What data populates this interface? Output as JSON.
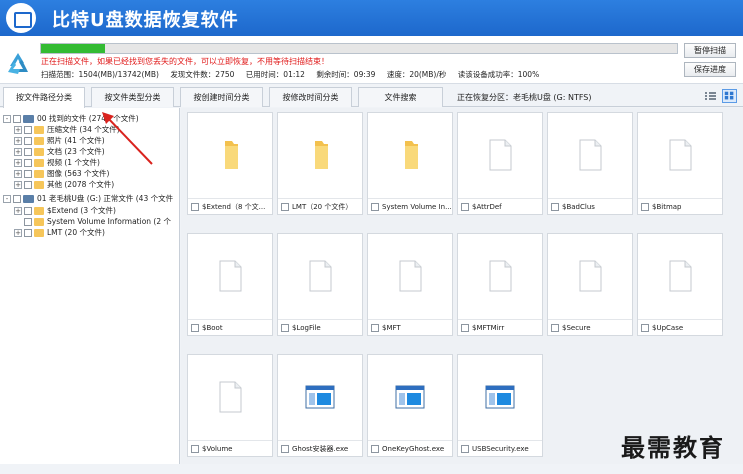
{
  "app": {
    "title": "比特U盘数据恢复软件"
  },
  "scan": {
    "progress": 0.1,
    "warning": "正在扫描文件，如果已经找到您丢失的文件，可以立即恢复，不用等待扫描结束！",
    "range": "扫描范围：1504(MB)/13742(MB)",
    "files_found": "发现文件数：2750",
    "elapsed": "已用时间：01:12",
    "remaining": "剩余时间：09:39",
    "speed": "速度：20(MB)/秒",
    "read_rate": "读该设备成功率：100%",
    "pause_label": "暂停扫描",
    "save_label": "保存进度"
  },
  "tabs": {
    "items": [
      "按文件路径分类",
      "按文件类型分类",
      "按创建时间分类",
      "按修改时间分类",
      "文件搜索"
    ],
    "current_partition": "正在恢复分区：老毛桃U盘 (G: NTFS)"
  },
  "tree": {
    "nodes": [
      {
        "expander": "-",
        "label": "00 找到的文件",
        "count": "(2740 个文件)",
        "kind": "drive"
      },
      {
        "expander": "+",
        "label": "压缩文件",
        "count": "(34 个文件)",
        "kind": "folder"
      },
      {
        "expander": "+",
        "label": "照片",
        "count": "(41 个文件)",
        "kind": "folder"
      },
      {
        "expander": "+",
        "label": "文档",
        "count": "(23 个文件)",
        "kind": "folder"
      },
      {
        "expander": "+",
        "label": "视频",
        "count": "(1 个文件)",
        "kind": "folder"
      },
      {
        "expander": "+",
        "label": "图像",
        "count": "(563 个文件)",
        "kind": "folder"
      },
      {
        "expander": "+",
        "label": "其他",
        "count": "(2078 个文件)",
        "kind": "folder"
      },
      {
        "expander": "-",
        "label": "01 老毛桃U盘",
        "count": "(G:) 正常文件 (43 个文件",
        "kind": "drive"
      },
      {
        "expander": "+",
        "label": "$Extend",
        "count": "(3 个文件)",
        "kind": "folder"
      },
      {
        "expander": "",
        "label": "System Volume Information",
        "count": "(2 个",
        "kind": "folder"
      },
      {
        "expander": "+",
        "label": "LMT",
        "count": "(20 个文件)",
        "kind": "folder"
      }
    ]
  },
  "files": [
    {
      "name": "$Extend（8 个文...",
      "icon": "folder-icon"
    },
    {
      "name": "LMT（20 个文件）",
      "icon": "folder-icon"
    },
    {
      "name": "System Volume In...",
      "icon": "folder-icon"
    },
    {
      "name": "$AttrDef",
      "icon": "file-icon"
    },
    {
      "name": "$BadClus",
      "icon": "file-icon"
    },
    {
      "name": "$Bitmap",
      "icon": "file-icon"
    },
    {
      "name": "$Boot",
      "icon": "file-icon"
    },
    {
      "name": "$LogFile",
      "icon": "file-icon"
    },
    {
      "name": "$MFT",
      "icon": "file-icon"
    },
    {
      "name": "$MFTMirr",
      "icon": "file-icon"
    },
    {
      "name": "$Secure",
      "icon": "file-icon"
    },
    {
      "name": "$UpCase",
      "icon": "file-icon"
    },
    {
      "name": "$Volume",
      "icon": "file-icon"
    },
    {
      "name": "Ghost安装器.exe",
      "icon": "exe-icon"
    },
    {
      "name": "OneKeyGhost.exe",
      "icon": "exe-icon"
    },
    {
      "name": "USBSecurity.exe",
      "icon": "exe-icon"
    }
  ],
  "watermark": "最需教育",
  "colors": {
    "brand": "#1d68cc",
    "progress": "#33bb33",
    "warning": "#e01818",
    "folder": "#f6c65a",
    "arrow": "#d9231e"
  }
}
